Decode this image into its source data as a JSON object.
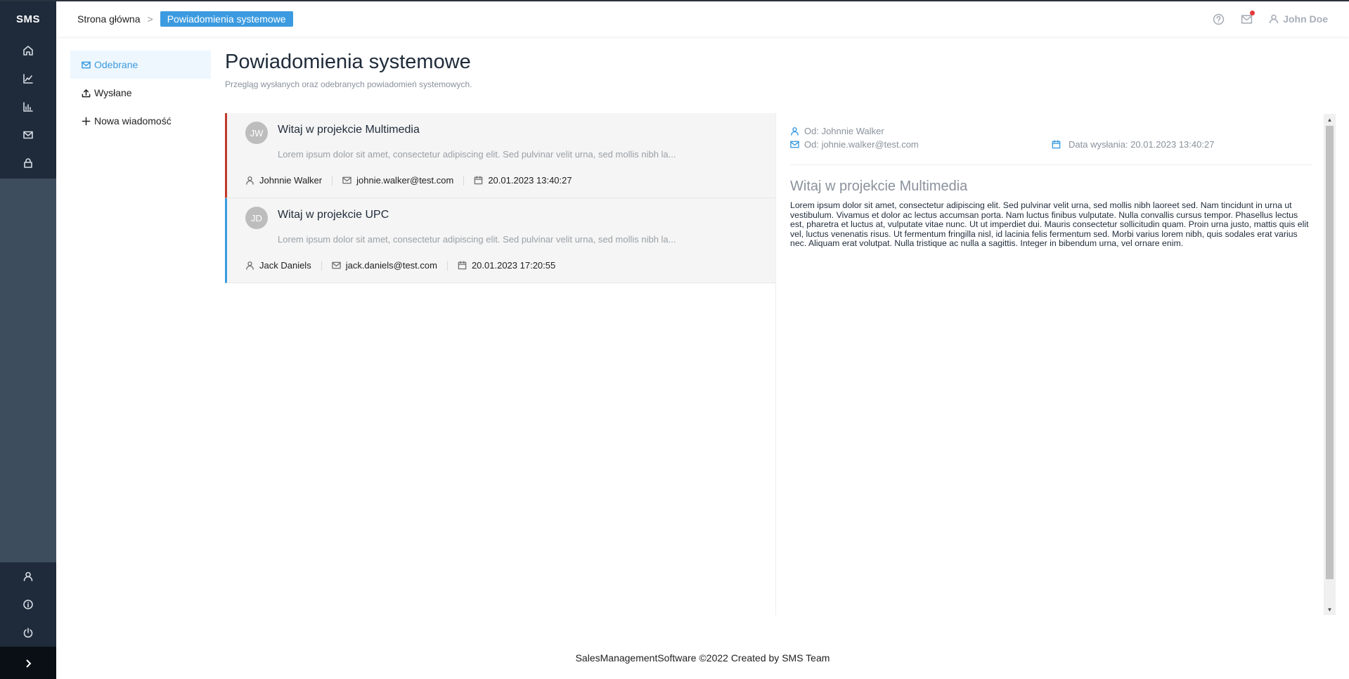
{
  "app": {
    "logo": "SMS"
  },
  "header": {
    "breadcrumb": {
      "home": "Strona główna",
      "separator": ">",
      "current": "Powiadomienia systemowe"
    },
    "user_name": "John Doe"
  },
  "submenu": {
    "items": [
      {
        "label": "Odebrane",
        "icon": "inbox-icon"
      },
      {
        "label": "Wysłane",
        "icon": "upload-icon"
      },
      {
        "label": "Nowa wiadomość",
        "icon": "plus-icon"
      }
    ]
  },
  "page": {
    "title": "Powiadomienia systemowe",
    "subtitle": "Przegląg wysłanych oraz odebranych powiadomień systemowych."
  },
  "messages": [
    {
      "initials": "JW",
      "title": "Witaj w projekcie Multimedia",
      "preview": "Lorem ipsum dolor sit amet, consectetur adipiscing elit. Sed pulvinar velit urna, sed mollis nibh la...",
      "author": "Johnnie Walker",
      "email": "johnie.walker@test.com",
      "date": "20.01.2023 13:40:27"
    },
    {
      "initials": "JD",
      "title": "Witaj w projekcie UPC",
      "preview": "Lorem ipsum dolor sit amet, consectetur adipiscing elit. Sed pulvinar velit urna, sed mollis nibh la...",
      "author": "Jack Daniels",
      "email": "jack.daniels@test.com",
      "date": "20.01.2023 17:20:55"
    }
  ],
  "detail": {
    "from": "Od: Johnnie Walker",
    "from_email": "Od: johnie.walker@test.com",
    "sent_date": "Data wysłania: 20.01.2023 13:40:27",
    "title": "Witaj w projekcie Multimedia",
    "body": "Lorem ipsum dolor sit amet, consectetur adipiscing elit. Sed pulvinar velit urna, sed mollis nibh laoreet sed. Nam tincidunt in urna ut vestibulum. Vivamus et dolor ac lectus accumsan porta. Nam luctus finibus vulputate. Nulla convallis cursus tempor. Phasellus lectus est, pharetra et luctus at, vulputate vitae nunc. Ut ut imperdiet dui. Mauris consectetur sollicitudin quam. Proin urna justo, mattis quis elit vel, luctus venenatis risus. Ut fermentum fringilla nisl, id lacinia felis fermentum sed. Morbi varius lorem nibh, quis sodales erat varius nec. Aliquam erat volutpat. Nulla tristique ac nulla a sagittis. Integer in bibendum urna, vel ornare enim."
  },
  "footer": {
    "text": "SalesManagementSoftware ©2022 Created by SMS Team"
  },
  "colors": {
    "primary": "#3c9be0",
    "sidebar": "#1f2b3a",
    "selected_border": "#c0392b",
    "badge": "#e33b3b"
  }
}
